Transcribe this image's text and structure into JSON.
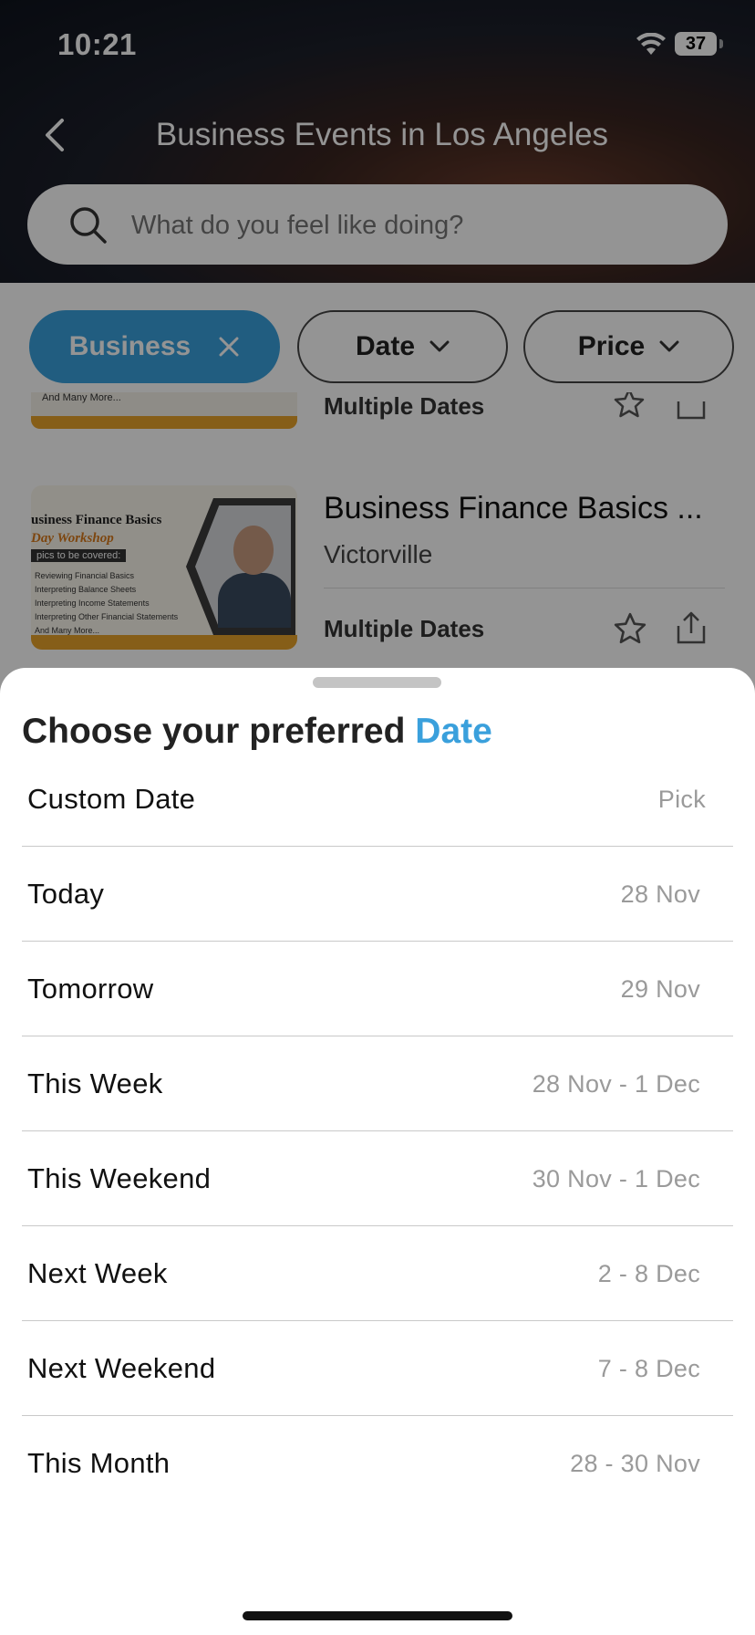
{
  "status_bar": {
    "time": "10:21",
    "battery": "37"
  },
  "header": {
    "title": "Business Events in Los Angeles",
    "search_placeholder": "What do you feel like doing?"
  },
  "filters": {
    "category": "Business",
    "date": "Date",
    "price": "Price"
  },
  "events": {
    "previous_card": {
      "dates": "Multiple Dates",
      "thumb_text": "And Many More..."
    },
    "card": {
      "title": "Business Finance Basics ...",
      "location": "Victorville",
      "dates": "Multiple Dates",
      "thumb_line1": "usiness Finance Basics",
      "thumb_line2": "Day Workshop",
      "thumb_line3": "pics to be covered:",
      "thumb_items": [
        "Reviewing Financial Basics",
        "Interpreting Balance Sheets",
        "Interpreting Income Statements",
        "Interpreting Other Financial Statements",
        "And Many More..."
      ]
    }
  },
  "sheet": {
    "title_prefix": "Choose your preferred",
    "title_accent": "Date",
    "accent_color": "#3aa0dc",
    "options": [
      {
        "label": "Custom Date",
        "value": "Pick"
      },
      {
        "label": "Today",
        "value": "28 Nov"
      },
      {
        "label": "Tomorrow",
        "value": "29 Nov"
      },
      {
        "label": "This Week",
        "value": "28 Nov - 1 Dec"
      },
      {
        "label": "This Weekend",
        "value": "30 Nov - 1 Dec"
      },
      {
        "label": "Next Week",
        "value": "2 - 8 Dec"
      },
      {
        "label": "Next Weekend",
        "value": "7 - 8 Dec"
      },
      {
        "label": "This Month",
        "value": "28 - 30 Nov"
      }
    ]
  },
  "icons": [
    "back-chevron-icon",
    "search-icon",
    "wifi-icon",
    "close-icon",
    "chevron-down-icon",
    "star-icon",
    "share-icon"
  ]
}
